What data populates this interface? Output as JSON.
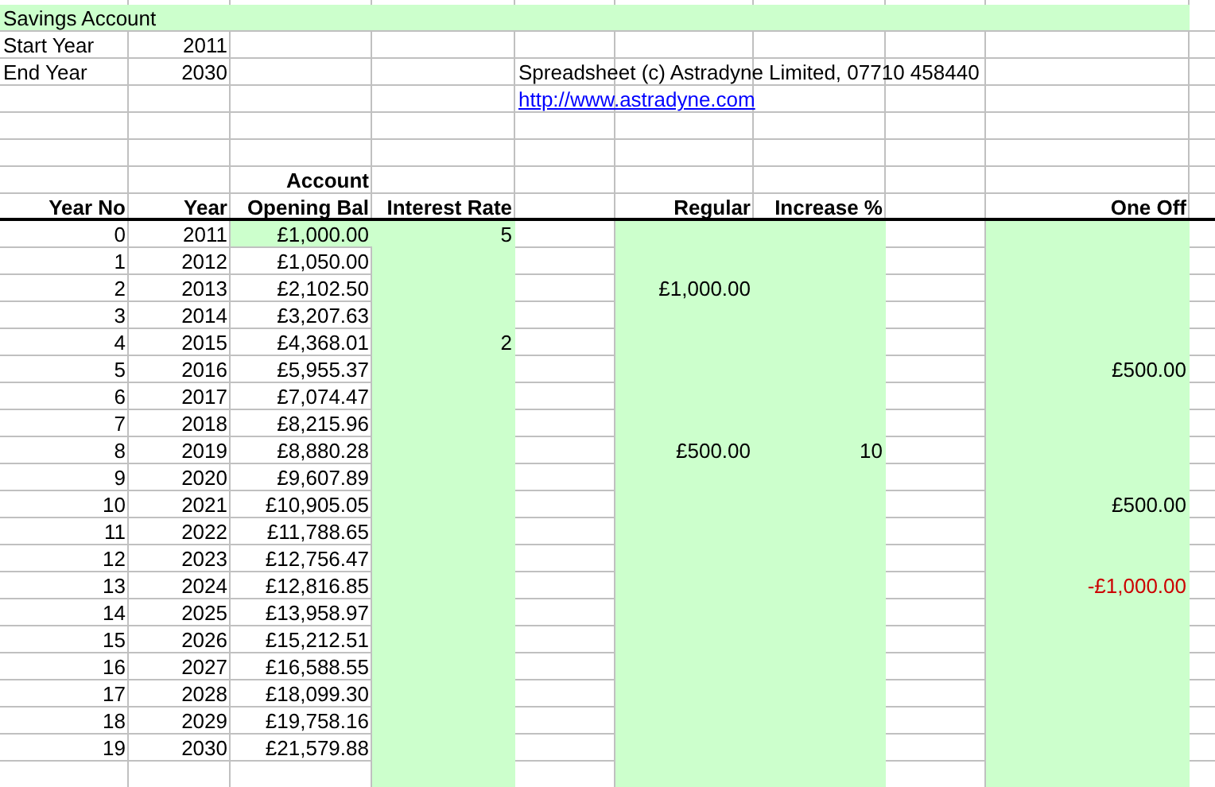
{
  "title": "Savings Account",
  "settings": [
    {
      "label": "Start Year",
      "value": "2011"
    },
    {
      "label": "End Year",
      "value": "2030"
    }
  ],
  "copyright": "Spreadsheet (c) Astradyne Limited, 07710 458440",
  "link": "http://www.astradyne.com",
  "columns": [
    {
      "header": "Year No",
      "input": false
    },
    {
      "header": "Year",
      "input": false
    },
    {
      "header_top": "Account",
      "header": "Opening Bal",
      "input": false
    },
    {
      "header": "Interest Rate",
      "input": true
    },
    {
      "header": "Regular",
      "input": true
    },
    {
      "header": "Increase %",
      "input": true
    },
    {
      "header": "One Off",
      "input": true
    }
  ],
  "rows": [
    {
      "year_no": "0",
      "year": "2011",
      "opening_bal": "£1,000.00",
      "opening_input": true,
      "interest_rate": "5"
    },
    {
      "year_no": "1",
      "year": "2012",
      "opening_bal": "£1,050.00",
      "opening_input": false
    },
    {
      "year_no": "2",
      "year": "2013",
      "opening_bal": "£2,102.50",
      "opening_input": false,
      "regular": "£1,000.00"
    },
    {
      "year_no": "3",
      "year": "2014",
      "opening_bal": "£3,207.63",
      "opening_input": false
    },
    {
      "year_no": "4",
      "year": "2015",
      "opening_bal": "£4,368.01",
      "opening_input": false,
      "interest_rate": "2"
    },
    {
      "year_no": "5",
      "year": "2016",
      "opening_bal": "£5,955.37",
      "opening_input": false,
      "one_off": {
        "text": "£500.00",
        "negative": false
      }
    },
    {
      "year_no": "6",
      "year": "2017",
      "opening_bal": "£7,074.47",
      "opening_input": false
    },
    {
      "year_no": "7",
      "year": "2018",
      "opening_bal": "£8,215.96",
      "opening_input": false
    },
    {
      "year_no": "8",
      "year": "2019",
      "opening_bal": "£8,880.28",
      "opening_input": false,
      "regular": "£500.00",
      "increase": "10"
    },
    {
      "year_no": "9",
      "year": "2020",
      "opening_bal": "£9,607.89",
      "opening_input": false
    },
    {
      "year_no": "10",
      "year": "2021",
      "opening_bal": "£10,905.05",
      "opening_input": false,
      "one_off": {
        "text": "£500.00",
        "negative": false
      }
    },
    {
      "year_no": "11",
      "year": "2022",
      "opening_bal": "£11,788.65",
      "opening_input": false
    },
    {
      "year_no": "12",
      "year": "2023",
      "opening_bal": "£12,756.47",
      "opening_input": false
    },
    {
      "year_no": "13",
      "year": "2024",
      "opening_bal": "£12,816.85",
      "opening_input": false,
      "one_off": {
        "text": "-£1,000.00",
        "negative": true
      }
    },
    {
      "year_no": "14",
      "year": "2025",
      "opening_bal": "£13,958.97",
      "opening_input": false
    },
    {
      "year_no": "15",
      "year": "2026",
      "opening_bal": "£15,212.51",
      "opening_input": false
    },
    {
      "year_no": "16",
      "year": "2027",
      "opening_bal": "£16,588.55",
      "opening_input": false
    },
    {
      "year_no": "17",
      "year": "2028",
      "opening_bal": "£18,099.30",
      "opening_input": false
    },
    {
      "year_no": "18",
      "year": "2029",
      "opening_bal": "£19,758.16",
      "opening_input": false
    },
    {
      "year_no": "19",
      "year": "2030",
      "opening_bal": "£21,579.88",
      "opening_input": false
    }
  ]
}
